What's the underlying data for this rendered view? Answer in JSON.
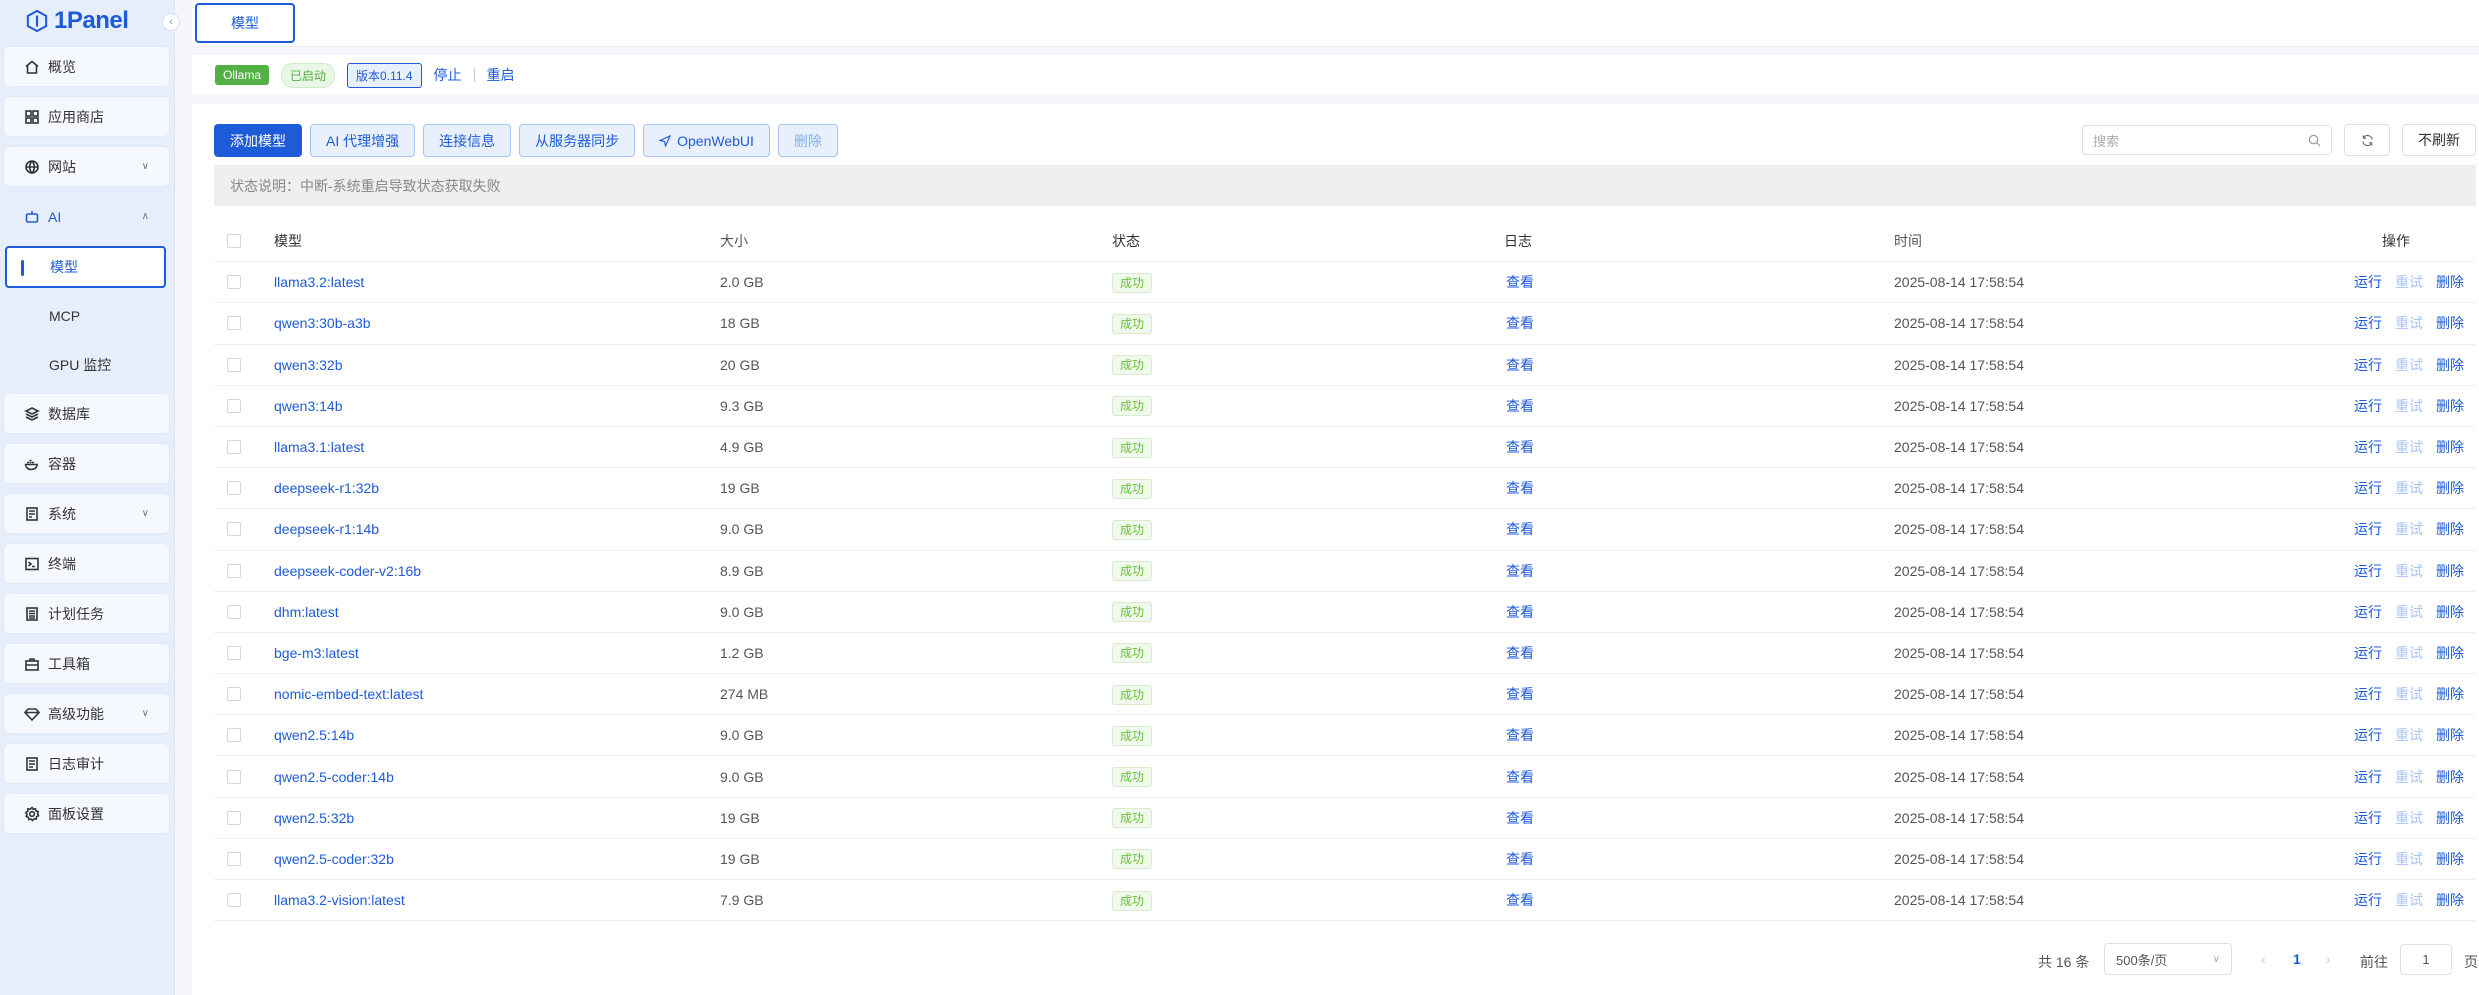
{
  "brand": {
    "name": "1Panel"
  },
  "sidebar": {
    "items": [
      {
        "key": "overview",
        "label": "概览",
        "icon": "home-icon"
      },
      {
        "key": "appstore",
        "label": "应用商店",
        "icon": "grid-icon"
      },
      {
        "key": "website",
        "label": "网站",
        "icon": "globe-icon",
        "expandable": true
      },
      {
        "key": "ai",
        "label": "AI",
        "icon": "robot-icon",
        "expanded": true
      },
      {
        "key": "database",
        "label": "数据库",
        "icon": "layers-icon"
      },
      {
        "key": "container",
        "label": "容器",
        "icon": "docker-icon"
      },
      {
        "key": "system",
        "label": "系统",
        "icon": "server-icon",
        "expandable": true
      },
      {
        "key": "terminal",
        "label": "终端",
        "icon": "terminal-icon"
      },
      {
        "key": "cron",
        "label": "计划任务",
        "icon": "list-icon"
      },
      {
        "key": "toolbox",
        "label": "工具箱",
        "icon": "toolbox-icon"
      },
      {
        "key": "advanced",
        "label": "高级功能",
        "icon": "diamond-icon",
        "expandable": true
      },
      {
        "key": "audit",
        "label": "日志审计",
        "icon": "log-icon"
      },
      {
        "key": "settings",
        "label": "面板设置",
        "icon": "gear-icon"
      }
    ],
    "ai_sub": [
      {
        "label": "模型",
        "active": true
      },
      {
        "label": "MCP"
      },
      {
        "label": "GPU 监控"
      }
    ]
  },
  "topbar": {
    "tab": "模型"
  },
  "appbar": {
    "app": "Ollama",
    "status": "已启动",
    "version": "版本0.11.4",
    "stop": "停止",
    "restart": "重启"
  },
  "toolbar": {
    "add": "添加模型",
    "proxy": "AI 代理增强",
    "conn": "连接信息",
    "sync": "从服务器同步",
    "webui": "OpenWebUI",
    "delete": "删除",
    "search_placeholder": "搜索",
    "no_refresh": "不刷新"
  },
  "notice": "状态说明：中断-系统重启导致状态获取失败",
  "table": {
    "headers": {
      "name": "模型",
      "size": "大小",
      "status": "状态",
      "log": "日志",
      "time": "时间",
      "ops": "操作"
    },
    "rows": [
      {
        "name": "llama3.2:latest",
        "size": "2.0 GB",
        "status": "成功",
        "log": "查看",
        "time": "2025-08-14 17:58:54"
      },
      {
        "name": "qwen3:30b-a3b",
        "size": "18 GB",
        "status": "成功",
        "log": "查看",
        "time": "2025-08-14 17:58:54"
      },
      {
        "name": "qwen3:32b",
        "size": "20 GB",
        "status": "成功",
        "log": "查看",
        "time": "2025-08-14 17:58:54"
      },
      {
        "name": "qwen3:14b",
        "size": "9.3 GB",
        "status": "成功",
        "log": "查看",
        "time": "2025-08-14 17:58:54"
      },
      {
        "name": "llama3.1:latest",
        "size": "4.9 GB",
        "status": "成功",
        "log": "查看",
        "time": "2025-08-14 17:58:54"
      },
      {
        "name": "deepseek-r1:32b",
        "size": "19 GB",
        "status": "成功",
        "log": "查看",
        "time": "2025-08-14 17:58:54"
      },
      {
        "name": "deepseek-r1:14b",
        "size": "9.0 GB",
        "status": "成功",
        "log": "查看",
        "time": "2025-08-14 17:58:54"
      },
      {
        "name": "deepseek-coder-v2:16b",
        "size": "8.9 GB",
        "status": "成功",
        "log": "查看",
        "time": "2025-08-14 17:58:54"
      },
      {
        "name": "dhm:latest",
        "size": "9.0 GB",
        "status": "成功",
        "log": "查看",
        "time": "2025-08-14 17:58:54"
      },
      {
        "name": "bge-m3:latest",
        "size": "1.2 GB",
        "status": "成功",
        "log": "查看",
        "time": "2025-08-14 17:58:54"
      },
      {
        "name": "nomic-embed-text:latest",
        "size": "274 MB",
        "status": "成功",
        "log": "查看",
        "time": "2025-08-14 17:58:54"
      },
      {
        "name": "qwen2.5:14b",
        "size": "9.0 GB",
        "status": "成功",
        "log": "查看",
        "time": "2025-08-14 17:58:54"
      },
      {
        "name": "qwen2.5-coder:14b",
        "size": "9.0 GB",
        "status": "成功",
        "log": "查看",
        "time": "2025-08-14 17:58:54"
      },
      {
        "name": "qwen2.5:32b",
        "size": "19 GB",
        "status": "成功",
        "log": "查看",
        "time": "2025-08-14 17:58:54"
      },
      {
        "name": "qwen2.5-coder:32b",
        "size": "19 GB",
        "status": "成功",
        "log": "查看",
        "time": "2025-08-14 17:58:54"
      },
      {
        "name": "llama3.2-vision:latest",
        "size": "7.9 GB",
        "status": "成功",
        "log": "查看",
        "time": "2025-08-14 17:58:54"
      }
    ],
    "ops": {
      "run": "运行",
      "retry": "重试",
      "delete": "删除"
    }
  },
  "pager": {
    "total": "共 16 条",
    "page_size": "500条/页",
    "current": "1",
    "goto": "前往",
    "goto_value": "1",
    "page_suffix": "页"
  }
}
